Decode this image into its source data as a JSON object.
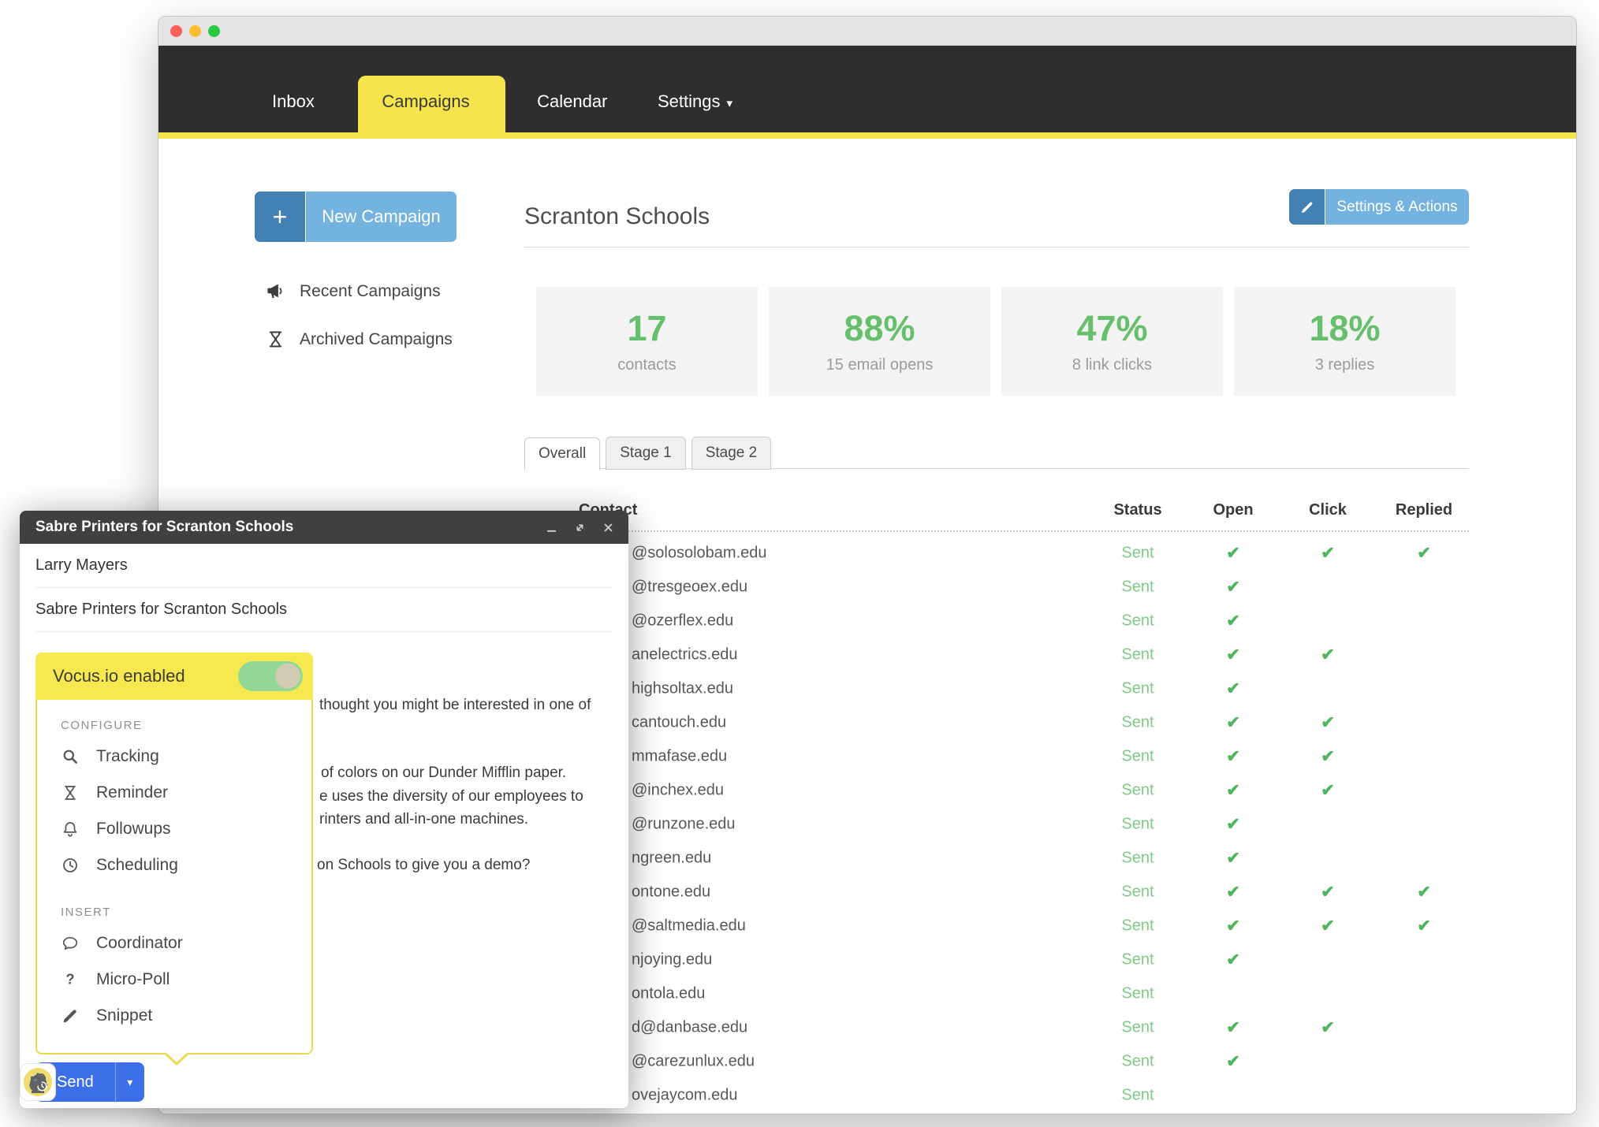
{
  "nav": {
    "items": [
      {
        "label": "Inbox",
        "active": false,
        "has_caret": false
      },
      {
        "label": "Campaigns",
        "active": true,
        "has_caret": false
      },
      {
        "label": "Calendar",
        "active": false,
        "has_caret": false
      },
      {
        "label": "Settings",
        "active": false,
        "has_caret": true
      }
    ]
  },
  "sidebar": {
    "new_campaign_label": "New Campaign",
    "items": [
      {
        "icon": "megaphone-icon",
        "label": "Recent Campaigns"
      },
      {
        "icon": "hourglass-icon",
        "label": "Archived Campaigns"
      }
    ]
  },
  "campaign": {
    "title": "Scranton Schools",
    "settings_button_label": "Settings & Actions",
    "stats": [
      {
        "value": "17",
        "label": "contacts"
      },
      {
        "value": "88%",
        "label": "15 email opens"
      },
      {
        "value": "47%",
        "label": "8 link clicks"
      },
      {
        "value": "18%",
        "label": "3 replies"
      }
    ],
    "tabs": [
      {
        "label": "Overall",
        "active": true
      },
      {
        "label": "Stage 1",
        "active": false
      },
      {
        "label": "Stage 2",
        "active": false
      }
    ],
    "table": {
      "columns": [
        "Contact",
        "Status",
        "Open",
        "Click",
        "Replied"
      ],
      "rows": [
        {
          "email": "@solosolobam.edu",
          "status": "Sent",
          "open": true,
          "click": true,
          "replied": true
        },
        {
          "email": "@tresgeoex.edu",
          "status": "Sent",
          "open": true,
          "click": false,
          "replied": false
        },
        {
          "email": "@ozerflex.edu",
          "status": "Sent",
          "open": true,
          "click": false,
          "replied": false
        },
        {
          "email": "anelectrics.edu",
          "status": "Sent",
          "open": true,
          "click": true,
          "replied": false
        },
        {
          "email": "highsoltax.edu",
          "status": "Sent",
          "open": true,
          "click": false,
          "replied": false
        },
        {
          "email": "cantouch.edu",
          "status": "Sent",
          "open": true,
          "click": true,
          "replied": false
        },
        {
          "email": "mmafase.edu",
          "status": "Sent",
          "open": true,
          "click": true,
          "replied": false
        },
        {
          "email": "@inchex.edu",
          "status": "Sent",
          "open": true,
          "click": true,
          "replied": false
        },
        {
          "email": "@runzone.edu",
          "status": "Sent",
          "open": true,
          "click": false,
          "replied": false
        },
        {
          "email": "ngreen.edu",
          "status": "Sent",
          "open": true,
          "click": false,
          "replied": false
        },
        {
          "email": "ontone.edu",
          "status": "Sent",
          "open": true,
          "click": true,
          "replied": true
        },
        {
          "email": "@saltmedia.edu",
          "status": "Sent",
          "open": true,
          "click": true,
          "replied": true
        },
        {
          "email": "njoying.edu",
          "status": "Sent",
          "open": true,
          "click": false,
          "replied": false
        },
        {
          "email": "ontola.edu",
          "status": "Sent",
          "open": false,
          "click": false,
          "replied": false
        },
        {
          "email": "d@danbase.edu",
          "status": "Sent",
          "open": true,
          "click": true,
          "replied": false
        },
        {
          "email": "@carezunlux.edu",
          "status": "Sent",
          "open": true,
          "click": false,
          "replied": false
        },
        {
          "email": "ovejaycom.edu",
          "status": "Sent",
          "open": false,
          "click": false,
          "replied": false
        }
      ]
    }
  },
  "compose": {
    "title": "Sabre Printers for Scranton Schools",
    "window_controls": [
      "minimize-icon",
      "expand-icon",
      "close-icon"
    ],
    "recipient": "Larry Mayers",
    "subject": "Sabre Printers for Scranton Schools",
    "vocus": {
      "label": "Vocus.io enabled",
      "enabled": true
    },
    "menu": {
      "groups": [
        {
          "heading": "CONFIGURE",
          "items": [
            {
              "icon": "search-icon",
              "label": "Tracking"
            },
            {
              "icon": "hourglass-icon",
              "label": "Reminder"
            },
            {
              "icon": "bell-icon",
              "label": "Followups"
            },
            {
              "icon": "clock-icon",
              "label": "Scheduling"
            }
          ]
        },
        {
          "heading": "INSERT",
          "items": [
            {
              "icon": "speech-bubble-icon",
              "label": "Coordinator"
            },
            {
              "icon": "question-icon",
              "label": "Micro-Poll"
            },
            {
              "icon": "pencil-icon",
              "label": "Snippet"
            }
          ]
        }
      ]
    },
    "body_fragments": [
      "thought you might be interested in one of",
      "of colors on our Dunder Mifflin paper.",
      "e uses the diversity of our employees to",
      "rinters and all-in-one machines.",
      "on Schools to give you a demo?"
    ],
    "send_label": "Send",
    "toolbar": [
      {
        "icon": "vocus-icon"
      },
      {
        "icon": "format-icon"
      },
      {
        "icon": "attach-icon"
      },
      {
        "icon": "link-icon"
      },
      {
        "icon": "emoji-icon"
      },
      {
        "icon": "drive-icon"
      },
      {
        "icon": "image-icon"
      },
      {
        "icon": "confidential-icon"
      },
      {
        "icon": "pen-icon"
      }
    ]
  },
  "colors": {
    "accent_yellow": "#f5e44c",
    "blue_light": "#74b2e0",
    "blue_dark": "#4381b4",
    "send_blue": "#3d6fe8",
    "stat_green": "#65bf6b",
    "check_green": "#4eb65c",
    "sent_green": "#7fca84"
  }
}
